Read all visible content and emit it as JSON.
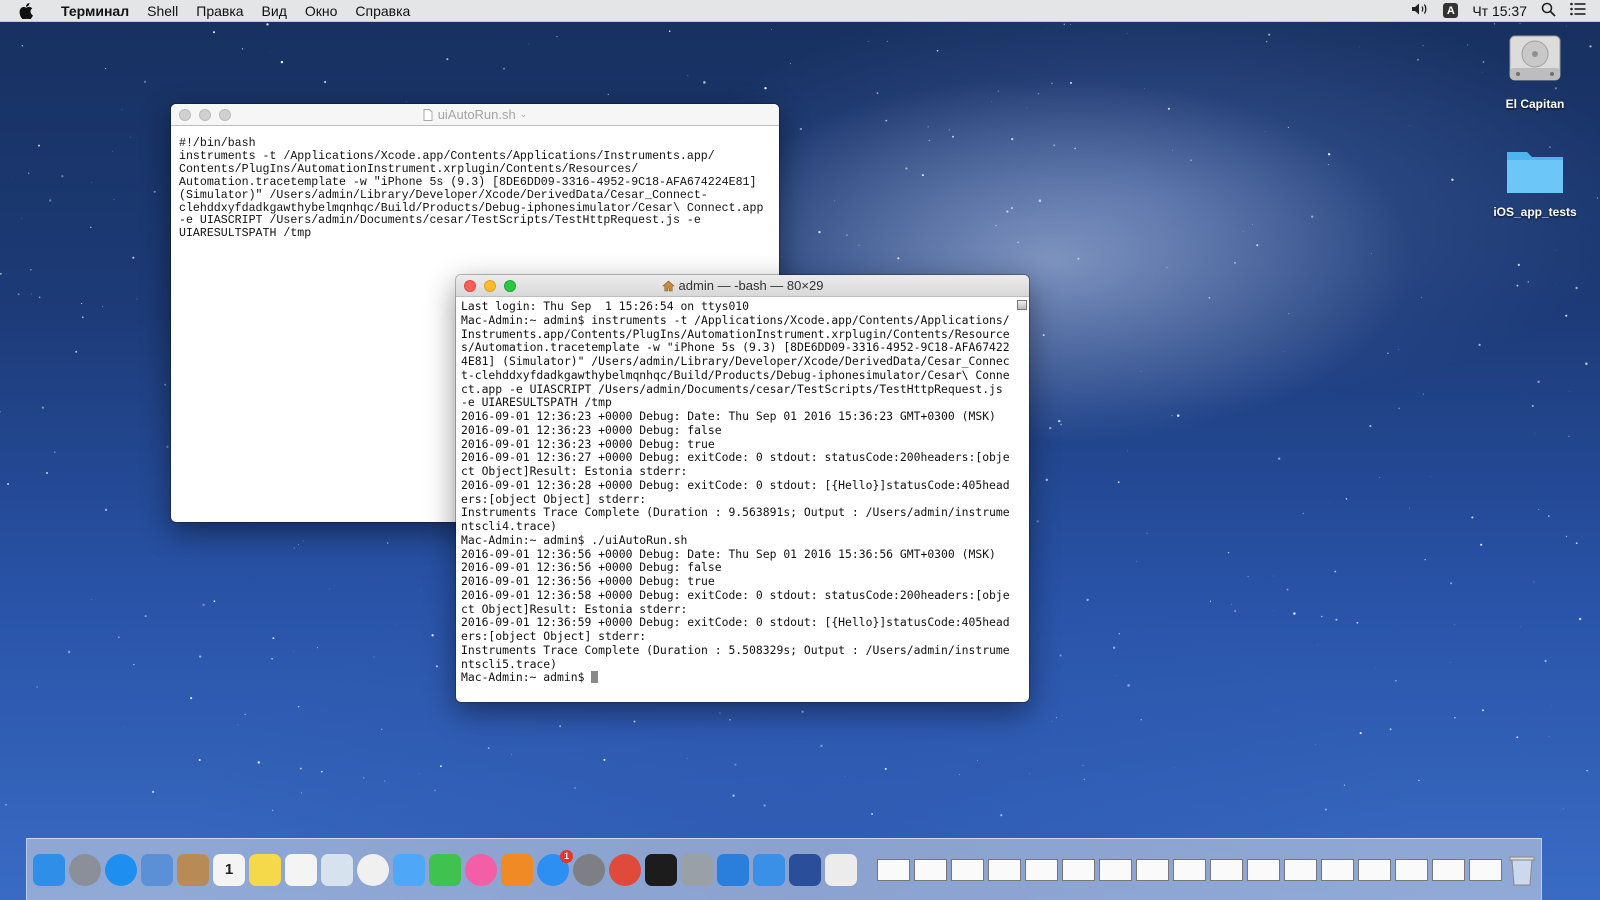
{
  "menubar": {
    "app_name": "Терминал",
    "items": [
      "Shell",
      "Правка",
      "Вид",
      "Окно",
      "Справка"
    ],
    "input_source": "A",
    "clock": "Чт 15:37"
  },
  "desktop": {
    "icons": [
      {
        "label": "El Capitan",
        "icon": "hard-drive-icon"
      },
      {
        "label": "iOS_app_tests",
        "icon": "folder-icon"
      }
    ]
  },
  "editor_window": {
    "title": "uiAutoRun.sh",
    "lines": [
      "#!/bin/bash",
      "",
      "instruments -t /Applications/Xcode.app/Contents/Applications/Instruments.app/",
      "Contents/PlugIns/AutomationInstrument.xrplugin/Contents/Resources/",
      "Automation.tracetemplate -w \"iPhone 5s (9.3) [8DE6DD09-3316-4952-9C18-AFA674224E81]",
      "(Simulator)\" /Users/admin/Library/Developer/Xcode/DerivedData/Cesar_Connect-",
      "clehddxyfdadkgawthybelmqnhqc/Build/Products/Debug-iphonesimulator/Cesar\\ Connect.app",
      "-e UIASCRIPT /Users/admin/Documents/cesar/TestScripts/TestHttpRequest.js -e",
      "UIARESULTSPATH /tmp"
    ]
  },
  "terminal_window": {
    "title": "admin — -bash — 80×29",
    "lines": [
      "Last login: Thu Sep  1 15:26:54 on ttys010",
      "Mac-Admin:~ admin$ instruments -t /Applications/Xcode.app/Contents/Applications/",
      "Instruments.app/Contents/PlugIns/AutomationInstrument.xrplugin/Contents/Resource",
      "s/Automation.tracetemplate -w \"iPhone 5s (9.3) [8DE6DD09-3316-4952-9C18-AFA67422",
      "4E81] (Simulator)\" /Users/admin/Library/Developer/Xcode/DerivedData/Cesar_Connec",
      "t-clehddxyfdadkgawthybelmqnhqc/Build/Products/Debug-iphonesimulator/Cesar\\ Conne",
      "ct.app -e UIASCRIPT /Users/admin/Documents/cesar/TestScripts/TestHttpRequest.js",
      "-e UIARESULTSPATH /tmp",
      "2016-09-01 12:36:23 +0000 Debug: Date: Thu Sep 01 2016 15:36:23 GMT+0300 (MSK)",
      "2016-09-01 12:36:23 +0000 Debug: false",
      "2016-09-01 12:36:23 +0000 Debug: true",
      "2016-09-01 12:36:27 +0000 Debug: exitCode: 0 stdout: statusCode:200headers:[obje",
      "ct Object]Result: Estonia stderr:",
      "2016-09-01 12:36:28 +0000 Debug: exitCode: 0 stdout: [{Hello}]statusCode:405head",
      "ers:[object Object] stderr:",
      "Instruments Trace Complete (Duration : 9.563891s; Output : /Users/admin/instrume",
      "ntscli4.trace)",
      "Mac-Admin:~ admin$ ./uiAutoRun.sh",
      "2016-09-01 12:36:56 +0000 Debug: Date: Thu Sep 01 2016 15:36:56 GMT+0300 (MSK)",
      "2016-09-01 12:36:56 +0000 Debug: false",
      "2016-09-01 12:36:56 +0000 Debug: true",
      "2016-09-01 12:36:58 +0000 Debug: exitCode: 0 stdout: statusCode:200headers:[obje",
      "ct Object]Result: Estonia stderr:",
      "2016-09-01 12:36:59 +0000 Debug: exitCode: 0 stdout: [{Hello}]statusCode:405head",
      "ers:[object Object] stderr:",
      "Instruments Trace Complete (Duration : 5.508329s; Output : /Users/admin/instrume",
      "ntscli5.trace)"
    ],
    "prompt": "Mac-Admin:~ admin$ "
  },
  "dock": {
    "apps": [
      {
        "name": "finder-icon",
        "color": "#2f8fe8"
      },
      {
        "name": "launchpad-icon",
        "color": "#8a8f99"
      },
      {
        "name": "safari-icon",
        "color": "#1e8ff0"
      },
      {
        "name": "mail-icon",
        "color": "#5b8fd6"
      },
      {
        "name": "contacts-icon",
        "color": "#b88a56"
      },
      {
        "name": "calendar-icon",
        "color": "#f4f4f4",
        "text": "1",
        "text_color": "#222"
      },
      {
        "name": "notes-icon",
        "color": "#f6d94a"
      },
      {
        "name": "reminders-icon",
        "color": "#f4f4f4"
      },
      {
        "name": "preview-icon",
        "color": "#d7e2ef"
      },
      {
        "name": "photos-icon",
        "color": "#f0f0f0"
      },
      {
        "name": "messages-icon",
        "color": "#4fa8f7"
      },
      {
        "name": "facetime-icon",
        "color": "#3fc24e"
      },
      {
        "name": "itunes-icon",
        "color": "#f35ea7"
      },
      {
        "name": "ibooks-icon",
        "color": "#f08a24"
      },
      {
        "name": "app-store-icon",
        "color": "#2d8ff2",
        "badge": "1"
      },
      {
        "name": "system-preferences-icon",
        "color": "#7d7f85"
      },
      {
        "name": "chrome-icon",
        "color": "#e04a3a"
      },
      {
        "name": "terminal-icon",
        "color": "#1c1c1c"
      },
      {
        "name": "utility-icon",
        "color": "#9aa0a8"
      },
      {
        "name": "xcode-icon",
        "color": "#2a7fdc"
      },
      {
        "name": "file-merge-icon",
        "color": "#3a8fe6"
      },
      {
        "name": "instruments-icon",
        "color": "#2a4e99"
      },
      {
        "name": "script-editor-icon",
        "color": "#ececec"
      }
    ],
    "documents_count": 17
  }
}
